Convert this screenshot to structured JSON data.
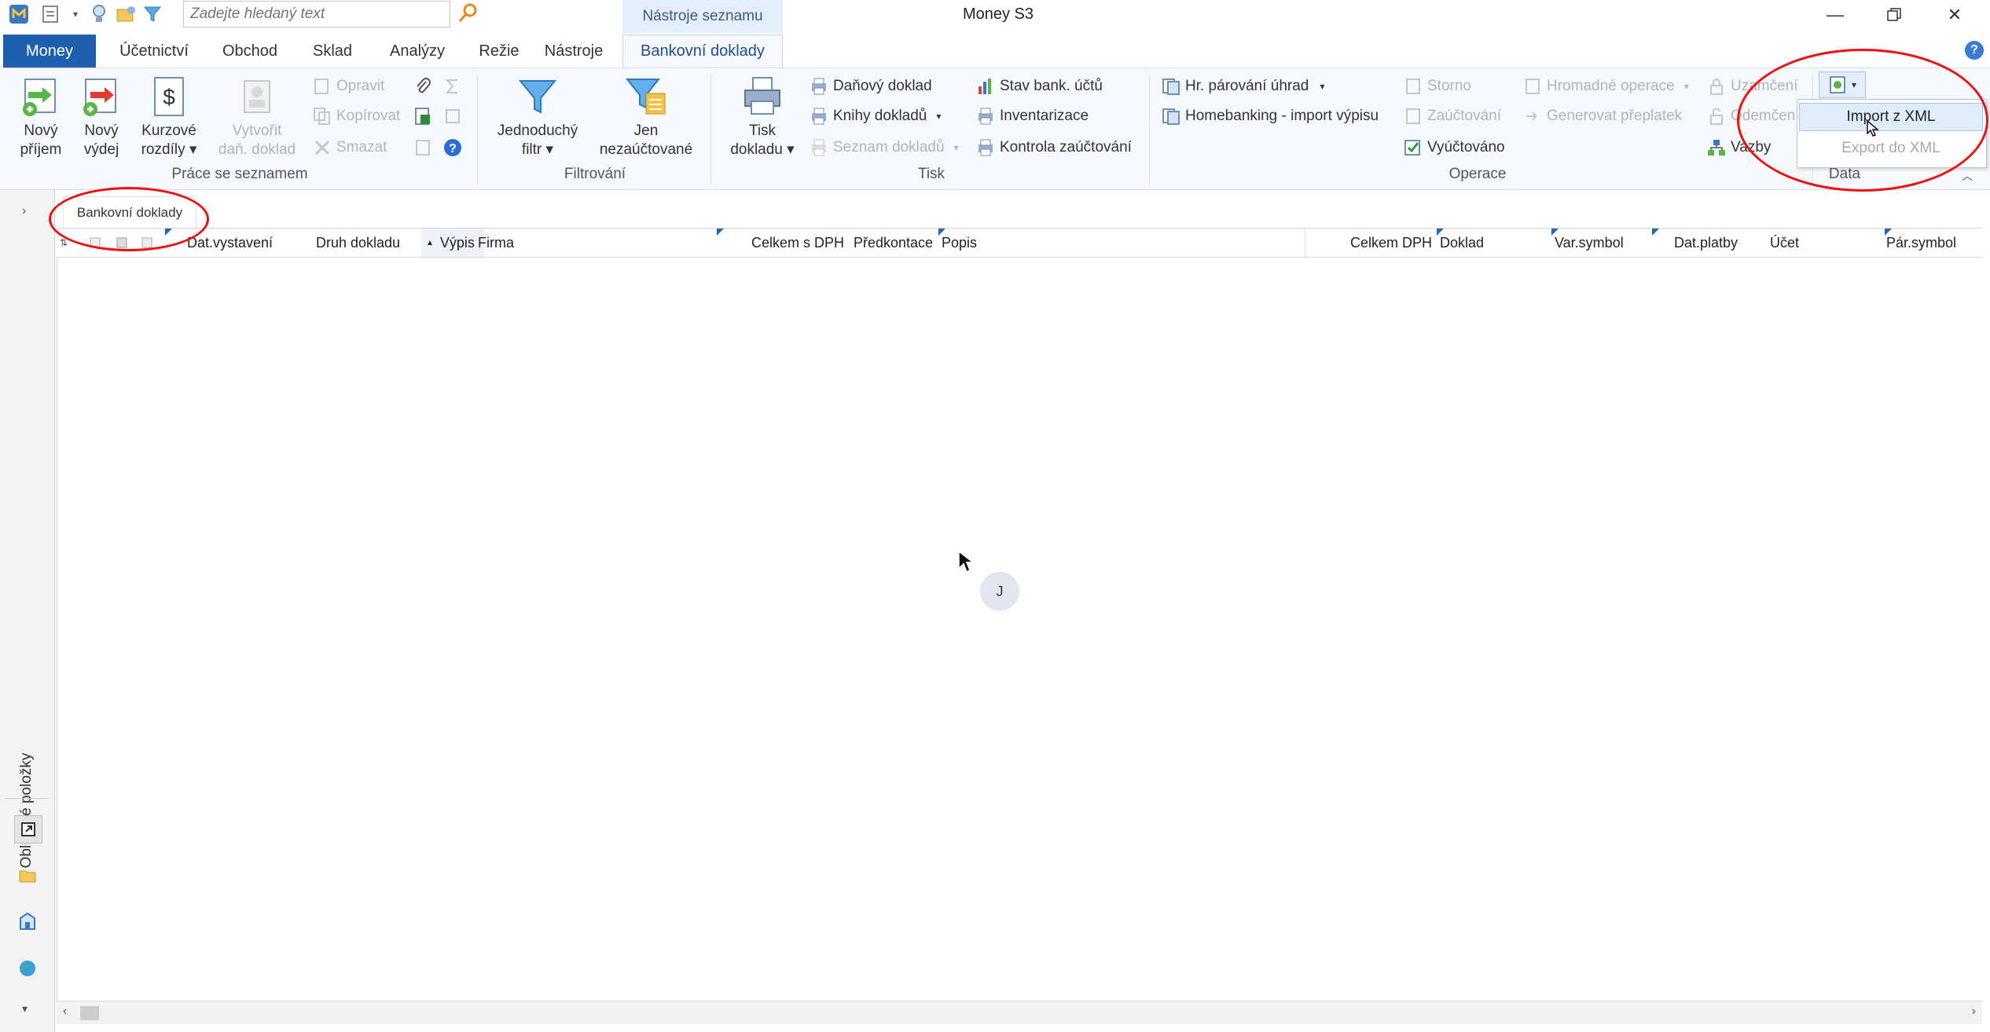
{
  "app": {
    "title": "Money S3",
    "search_placeholder": "Zadejte hledaný text",
    "context_tab_title": "Nástroje seznamu"
  },
  "tabs": [
    {
      "label": "Money"
    },
    {
      "label": "Účetnictví"
    },
    {
      "label": "Obchod"
    },
    {
      "label": "Sklad"
    },
    {
      "label": "Analýzy"
    },
    {
      "label": "Režie"
    },
    {
      "label": "Nástroje"
    },
    {
      "label": "Bankovní doklady"
    }
  ],
  "ribbon": {
    "prace": {
      "label": "Práce se seznamem",
      "novy_prijem": [
        "Nový",
        "příjem"
      ],
      "novy_vydej": [
        "Nový",
        "výdej"
      ],
      "kurzove": [
        "Kurzové",
        "rozdíly ▾"
      ],
      "vytvorit": [
        "Vytvořit",
        "daň. doklad"
      ],
      "opravit": "Opravit",
      "kopirovat": "Kopírovat",
      "smazat": "Smazat"
    },
    "filtrovani": {
      "label": "Filtrování",
      "jednoduchy": [
        "Jednoduchý",
        "filtr ▾"
      ],
      "jen": [
        "Jen",
        "nezaúčtované"
      ]
    },
    "tisk": {
      "label": "Tisk",
      "tisk_dokladu": [
        "Tisk",
        "dokladu ▾"
      ],
      "danovy": "Daňový doklad",
      "knihy": "Knihy dokladů",
      "seznam": "Seznam dokladů",
      "stav": "Stav bank. účtů",
      "inventarizace": "Inventarizace",
      "kontrola": "Kontrola zaúčtování"
    },
    "operace": {
      "label": "Operace",
      "hr_parovani": "Hr. párování úhrad",
      "homebanking": "Homebanking - import výpisu",
      "storno": "Storno",
      "zauctovani": "Zaúčtování",
      "vyuctovano": "Vyúčtováno",
      "hromadne": "Hromadné operace",
      "generovat": "Generovat přeplatek",
      "uzamceni": "Uzamčení",
      "odemceni": "Odemčení",
      "vazby": "Vazby"
    },
    "data": {
      "label": "Data",
      "menu": [
        "Import z XML",
        "Export do XML"
      ]
    }
  },
  "sidebar": {
    "label": "Oblíbené položky"
  },
  "document_tab": "Bankovní doklady",
  "columns": [
    "Dat.vystavení",
    "Druh dokladu",
    "Výpis",
    "Firma",
    "Celkem s DPH",
    "Předkontace",
    "Popis",
    "Celkem DPH",
    "Doklad",
    "Var.symbol",
    "Dat.platby",
    "Účet",
    "Pár.symbol"
  ],
  "sort_indicator": "▲",
  "avatar_initial": "J",
  "colors": {
    "accent": "#1f5fb0",
    "highlight": "#e11111"
  }
}
